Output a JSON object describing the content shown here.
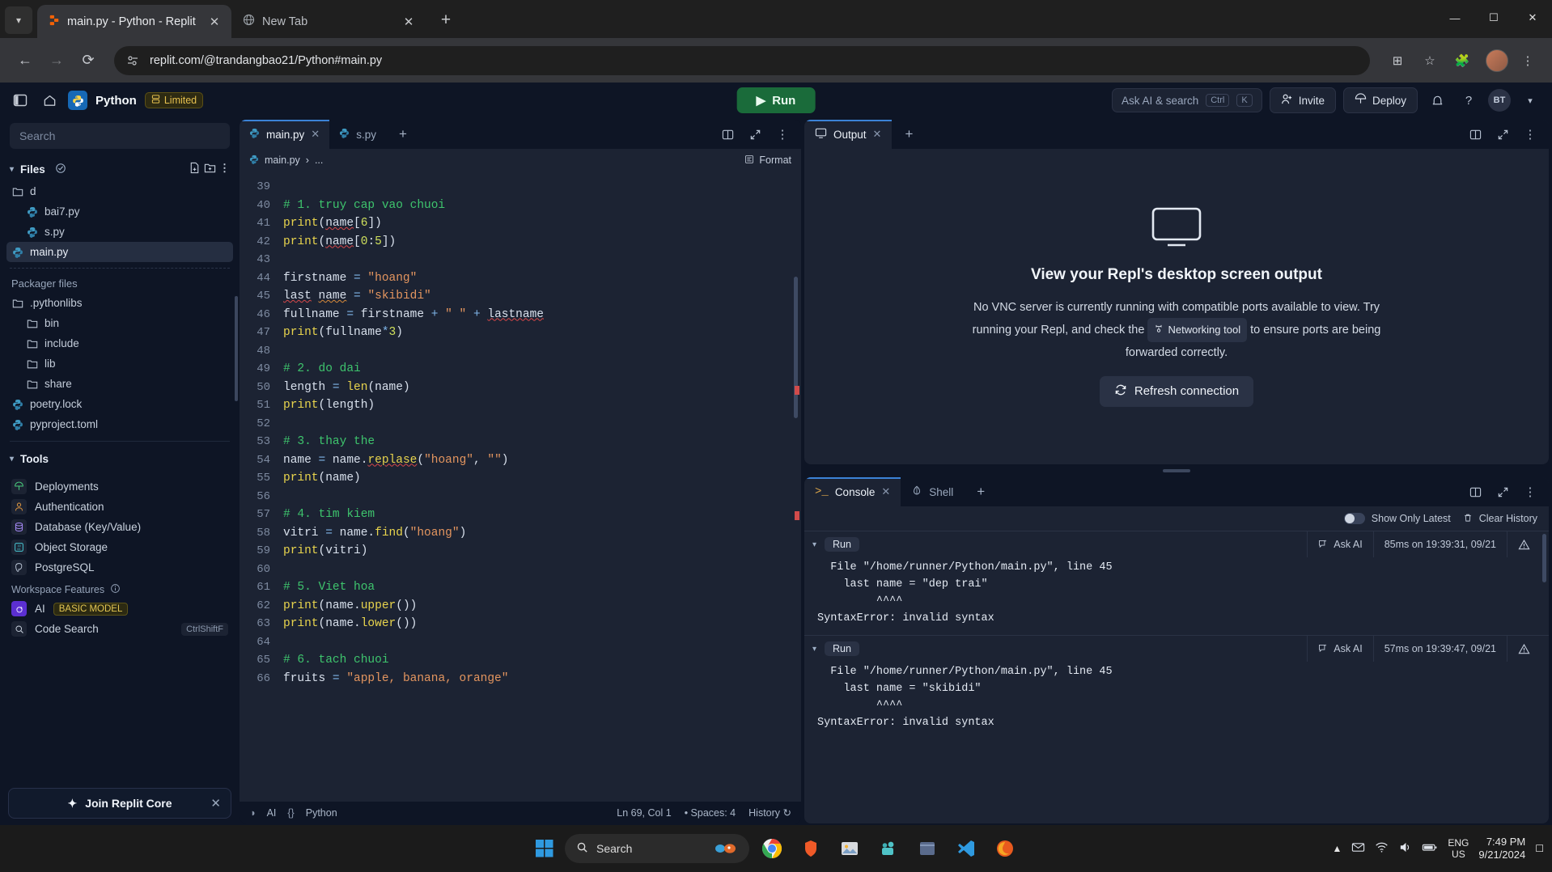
{
  "browser": {
    "tabs": [
      {
        "title": "main.py - Python - Replit",
        "icon": "replit-icon",
        "active": true
      },
      {
        "title": "New Tab",
        "icon": "globe-icon",
        "active": false
      }
    ],
    "new_tab_label": "+",
    "url": "replit.com/@trandangbao21/Python#main.py",
    "window_controls": {
      "minimize": "─",
      "maximize": "☐",
      "close": "✕"
    }
  },
  "topbar": {
    "repl_name": "Python",
    "limited_badge": "Limited",
    "run_label": "Run",
    "ask_ai": {
      "label": "Ask AI & search",
      "key1": "Ctrl",
      "key2": "K"
    },
    "invite_label": "Invite",
    "deploy_label": "Deploy",
    "avatar_initials": "BT"
  },
  "sidebar": {
    "search_placeholder": "Search",
    "files_header": "Files",
    "files": [
      {
        "name": "d",
        "icon": "folder-icon",
        "indent": 0,
        "selected": false
      },
      {
        "name": "bai7.py",
        "icon": "python-icon",
        "indent": 1,
        "selected": false
      },
      {
        "name": "s.py",
        "icon": "python-icon",
        "indent": 1,
        "selected": false
      },
      {
        "name": "main.py",
        "icon": "python-icon",
        "indent": 0,
        "selected": true
      }
    ],
    "packager_label": "Packager files",
    "packager_files": [
      {
        "name": ".pythonlibs",
        "icon": "folder-icon",
        "indent": 0
      },
      {
        "name": "bin",
        "icon": "folder-icon",
        "indent": 1
      },
      {
        "name": "include",
        "icon": "folder-icon",
        "indent": 1
      },
      {
        "name": "lib",
        "icon": "folder-icon",
        "indent": 1
      },
      {
        "name": "share",
        "icon": "folder-icon",
        "indent": 1
      },
      {
        "name": "poetry.lock",
        "icon": "python-icon",
        "indent": 0
      },
      {
        "name": "pyproject.toml",
        "icon": "python-icon",
        "indent": 0
      }
    ],
    "tools_header": "Tools",
    "tools": [
      {
        "label": "Deployments",
        "icon": "deploy-icon",
        "color": "#4ad07f"
      },
      {
        "label": "Authentication",
        "icon": "user-icon",
        "color": "#d99340"
      },
      {
        "label": "Database (Key/Value)",
        "icon": "database-icon",
        "color": "#a78bfa"
      },
      {
        "label": "Object Storage",
        "icon": "binary-icon",
        "color": "#48c7d4"
      },
      {
        "label": "PostgreSQL",
        "icon": "postgres-icon",
        "color": "#c3cede"
      }
    ],
    "workspace_features_label": "Workspace Features",
    "features": [
      {
        "label": "AI",
        "badge": "BASIC MODEL",
        "shortcut": "",
        "icon": "ai-icon"
      },
      {
        "label": "Code Search",
        "badge": "",
        "shortcut": "CtrlShiftF",
        "icon": "search-icon"
      }
    ],
    "join_core_label": "Join Replit Core"
  },
  "editor": {
    "tabs": [
      {
        "label": "main.py",
        "icon": "python-icon",
        "active": true
      },
      {
        "label": "s.py",
        "icon": "python-icon",
        "active": false
      }
    ],
    "add_tab_label": "+",
    "breadcrumb": {
      "file": "main.py",
      "sep": "›",
      "rest": "..."
    },
    "format_label": "Format",
    "first_line_number": 39,
    "lines": [
      {
        "n": 39,
        "tokens": []
      },
      {
        "n": 40,
        "tokens": [
          {
            "t": "# 1. truy cap vao chuoi",
            "c": "kw-com"
          }
        ]
      },
      {
        "n": 41,
        "tokens": [
          {
            "t": "print",
            "c": "kw-fn"
          },
          {
            "t": "(",
            "c": "kw-var"
          },
          {
            "t": "name",
            "c": "kw-var sq"
          },
          {
            "t": "[",
            "c": "kw-var"
          },
          {
            "t": "6",
            "c": "kw-num"
          },
          {
            "t": "])",
            "c": "kw-var"
          }
        ]
      },
      {
        "n": 42,
        "tokens": [
          {
            "t": "print",
            "c": "kw-fn"
          },
          {
            "t": "(",
            "c": "kw-var"
          },
          {
            "t": "name",
            "c": "kw-var sq"
          },
          {
            "t": "[",
            "c": "kw-var"
          },
          {
            "t": "0",
            "c": "kw-num"
          },
          {
            "t": ":",
            "c": "kw-var"
          },
          {
            "t": "5",
            "c": "kw-num"
          },
          {
            "t": "])",
            "c": "kw-var"
          }
        ]
      },
      {
        "n": 43,
        "tokens": []
      },
      {
        "n": 44,
        "tokens": [
          {
            "t": "firstname ",
            "c": "kw-var"
          },
          {
            "t": "= ",
            "c": "kw-op"
          },
          {
            "t": "\"hoang\"",
            "c": "kw-str"
          }
        ]
      },
      {
        "n": 45,
        "tokens": [
          {
            "t": "last",
            "c": "kw-var sq"
          },
          {
            "t": " ",
            "c": "kw-var"
          },
          {
            "t": "name",
            "c": "kw-var sq-o"
          },
          {
            "t": " ",
            "c": "kw-var"
          },
          {
            "t": "= ",
            "c": "kw-op"
          },
          {
            "t": "\"skibidi\"",
            "c": "kw-str"
          }
        ]
      },
      {
        "n": 46,
        "tokens": [
          {
            "t": "fullname ",
            "c": "kw-var"
          },
          {
            "t": "= ",
            "c": "kw-op"
          },
          {
            "t": "firstname ",
            "c": "kw-var"
          },
          {
            "t": "+ ",
            "c": "kw-op"
          },
          {
            "t": "\" \" ",
            "c": "kw-str"
          },
          {
            "t": "+ ",
            "c": "kw-op"
          },
          {
            "t": "lastname",
            "c": "kw-var sq"
          }
        ]
      },
      {
        "n": 47,
        "tokens": [
          {
            "t": "print",
            "c": "kw-fn"
          },
          {
            "t": "(fullname",
            "c": "kw-var"
          },
          {
            "t": "*",
            "c": "kw-op"
          },
          {
            "t": "3",
            "c": "kw-num"
          },
          {
            "t": ")",
            "c": "kw-var"
          }
        ]
      },
      {
        "n": 48,
        "tokens": []
      },
      {
        "n": 49,
        "tokens": [
          {
            "t": "# 2. do dai",
            "c": "kw-com"
          }
        ]
      },
      {
        "n": 50,
        "tokens": [
          {
            "t": "length ",
            "c": "kw-var"
          },
          {
            "t": "= ",
            "c": "kw-op"
          },
          {
            "t": "len",
            "c": "kw-fn"
          },
          {
            "t": "(name)",
            "c": "kw-var"
          }
        ]
      },
      {
        "n": 51,
        "tokens": [
          {
            "t": "print",
            "c": "kw-fn"
          },
          {
            "t": "(length)",
            "c": "kw-var"
          }
        ]
      },
      {
        "n": 52,
        "tokens": []
      },
      {
        "n": 53,
        "tokens": [
          {
            "t": "# 3. thay the",
            "c": "kw-com"
          }
        ]
      },
      {
        "n": 54,
        "tokens": [
          {
            "t": "name ",
            "c": "kw-var"
          },
          {
            "t": "= ",
            "c": "kw-op"
          },
          {
            "t": "name.",
            "c": "kw-var"
          },
          {
            "t": "replase",
            "c": "kw-meth sq"
          },
          {
            "t": "(",
            "c": "kw-var"
          },
          {
            "t": "\"hoang\"",
            "c": "kw-str"
          },
          {
            "t": ", ",
            "c": "kw-var"
          },
          {
            "t": "\"\"",
            "c": "kw-str"
          },
          {
            "t": ")",
            "c": "kw-var"
          }
        ]
      },
      {
        "n": 55,
        "tokens": [
          {
            "t": "print",
            "c": "kw-fn"
          },
          {
            "t": "(name)",
            "c": "kw-var"
          }
        ]
      },
      {
        "n": 56,
        "tokens": []
      },
      {
        "n": 57,
        "tokens": [
          {
            "t": "# 4. tim kiem",
            "c": "kw-com"
          }
        ]
      },
      {
        "n": 58,
        "tokens": [
          {
            "t": "vitri ",
            "c": "kw-var"
          },
          {
            "t": "= ",
            "c": "kw-op"
          },
          {
            "t": "name.",
            "c": "kw-var"
          },
          {
            "t": "find",
            "c": "kw-meth"
          },
          {
            "t": "(",
            "c": "kw-var"
          },
          {
            "t": "\"hoang\"",
            "c": "kw-str"
          },
          {
            "t": ")",
            "c": "kw-var"
          }
        ]
      },
      {
        "n": 59,
        "tokens": [
          {
            "t": "print",
            "c": "kw-fn"
          },
          {
            "t": "(vitri)",
            "c": "kw-var"
          }
        ]
      },
      {
        "n": 60,
        "tokens": []
      },
      {
        "n": 61,
        "tokens": [
          {
            "t": "# 5. Viet hoa",
            "c": "kw-com"
          }
        ]
      },
      {
        "n": 62,
        "tokens": [
          {
            "t": "print",
            "c": "kw-fn"
          },
          {
            "t": "(name.",
            "c": "kw-var"
          },
          {
            "t": "upper",
            "c": "kw-meth"
          },
          {
            "t": "())",
            "c": "kw-var"
          }
        ]
      },
      {
        "n": 63,
        "tokens": [
          {
            "t": "print",
            "c": "kw-fn"
          },
          {
            "t": "(name.",
            "c": "kw-var"
          },
          {
            "t": "lower",
            "c": "kw-meth"
          },
          {
            "t": "())",
            "c": "kw-var"
          }
        ]
      },
      {
        "n": 64,
        "tokens": []
      },
      {
        "n": 65,
        "tokens": [
          {
            "t": "# 6. tach chuoi",
            "c": "kw-com"
          }
        ]
      },
      {
        "n": 66,
        "tokens": [
          {
            "t": "fruits ",
            "c": "kw-var"
          },
          {
            "t": "= ",
            "c": "kw-op"
          },
          {
            "t": "\"apple, banana, orange\"",
            "c": "kw-str"
          }
        ]
      }
    ],
    "statusbar": {
      "ai_label": "AI",
      "lang_label": "Python",
      "cursor": "Ln 69, Col 1",
      "spaces": "Spaces: 4",
      "history": "History"
    }
  },
  "output_panel": {
    "tabs": [
      {
        "label": "Output",
        "icon": "monitor-icon",
        "active": true
      }
    ],
    "add_tab_label": "+",
    "title": "View your Repl's desktop screen output",
    "desc_before": "No VNC server is currently running with compatible ports available to view. Try running your Repl, and check the",
    "inline_chip": "Networking tool",
    "desc_after": "to ensure ports are being forwarded correctly.",
    "refresh_label": "Refresh connection"
  },
  "console_panel": {
    "tabs": [
      {
        "label": "Console",
        "icon": "terminal-icon",
        "active": true
      },
      {
        "label": "Shell",
        "icon": "shell-icon",
        "active": false
      }
    ],
    "add_tab_label": "+",
    "show_only_latest": "Show Only Latest",
    "clear_history": "Clear History",
    "runs": [
      {
        "label": "Run",
        "ask_ai": "Ask AI",
        "timing": "85ms on 19:39:31, 09/21",
        "output": "  File \"/home/runner/Python/main.py\", line 45\n    last name = \"dep trai\"\n         ^^^^\nSyntaxError: invalid syntax"
      },
      {
        "label": "Run",
        "ask_ai": "Ask AI",
        "timing": "57ms on 19:39:47, 09/21",
        "output": "  File \"/home/runner/Python/main.py\", line 45\n    last name = \"skibidi\"\n         ^^^^\nSyntaxError: invalid syntax"
      }
    ]
  },
  "taskbar": {
    "search_placeholder": "Search",
    "language": {
      "line1": "ENG",
      "line2": "US"
    },
    "clock": {
      "time": "7:49 PM",
      "date": "9/21/2024"
    }
  }
}
